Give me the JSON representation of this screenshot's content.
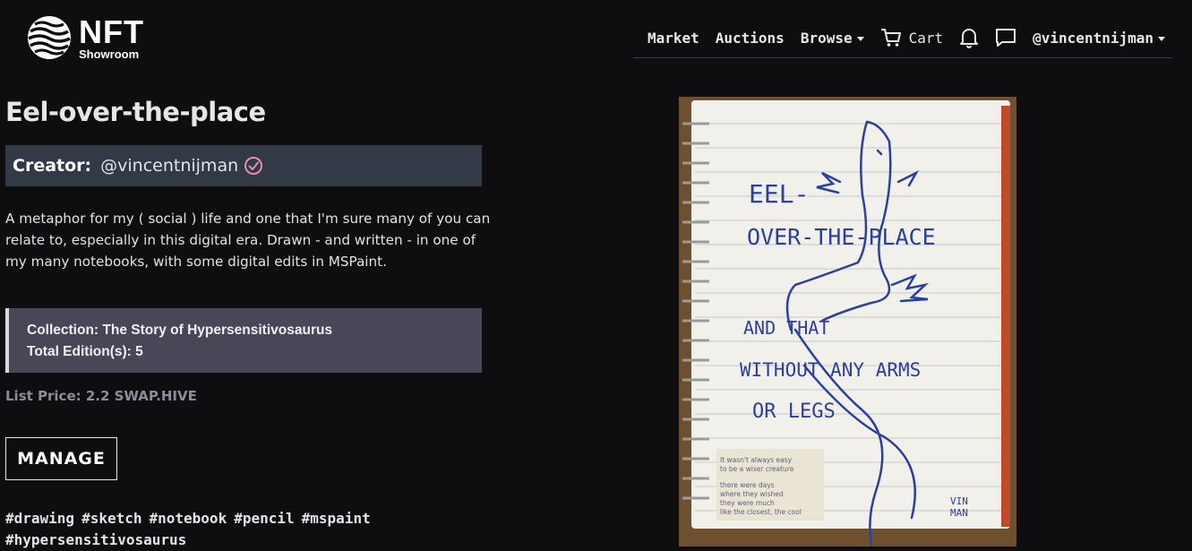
{
  "header": {
    "logo_main": "NFT",
    "logo_sub": "Showroom",
    "nav": [
      {
        "label": "Market",
        "dropdown": false
      },
      {
        "label": "Auctions",
        "dropdown": false
      },
      {
        "label": "Browse",
        "dropdown": true
      }
    ],
    "cart_label": "Cart",
    "user_label": "@vincentnijman"
  },
  "nft": {
    "title": "Eel-over-the-place",
    "creator_label": "Creator:",
    "creator_name": "@vincentnijman",
    "description": "A metaphor for my ( social ) life and one that I'm sure many of you can relate to, especially in this digital era. Drawn - and written - in one of my many notebooks, with some digital edits in MSPaint.",
    "collection_line": "Collection: The Story of Hypersensitivosaurus",
    "editions_line": "Total Edition(s): 5",
    "list_price": "List Price: 2.2 SWAP.HIVE",
    "manage_label": "MANAGE",
    "tags": [
      "#drawing",
      "#sketch",
      "#notebook",
      "#pencil",
      "#mspaint",
      "#hypersensitivosaurus"
    ]
  },
  "artwork": {
    "lines": [
      "EEL-",
      "OVER-THE-PLACE",
      "AND THAT",
      "WITHOUT ANY ARMS",
      "OR LEGS"
    ],
    "signature": [
      "VIN",
      "MAN"
    ],
    "note_lines": [
      "It wasn't always easy",
      "to be a wiser creature",
      "there were days",
      "where they wished",
      "they were much",
      "like the closest, the cool"
    ]
  },
  "colors": {
    "background": "#0e0e10",
    "creator_box": "#323a47",
    "collection_box": "#474758",
    "verified": "#e38fb4",
    "ink": "#2d3f9e"
  }
}
